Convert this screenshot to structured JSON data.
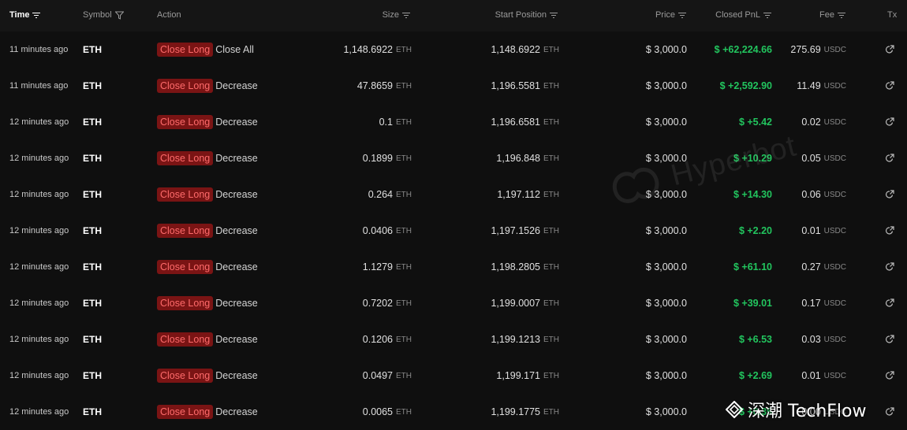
{
  "columns": {
    "time": "Time",
    "symbol": "Symbol",
    "action": "Action",
    "size": "Size",
    "start_position": "Start Position",
    "price": "Price",
    "closed_pnl": "Closed PnL",
    "fee": "Fee",
    "tx": "Tx"
  },
  "rows": [
    {
      "time": "11 minutes ago",
      "symbol": "ETH",
      "action": "Close Long",
      "subaction": "Close All",
      "size": "1,148.6922",
      "size_unit": "ETH",
      "start": "1,148.6922",
      "start_unit": "ETH",
      "price": "$ 3,000.0",
      "pnl": "$ +62,224.66",
      "fee": "275.69",
      "fee_unit": "USDC"
    },
    {
      "time": "11 minutes ago",
      "symbol": "ETH",
      "action": "Close Long",
      "subaction": "Decrease",
      "size": "47.8659",
      "size_unit": "ETH",
      "start": "1,196.5581",
      "start_unit": "ETH",
      "price": "$ 3,000.0",
      "pnl": "$ +2,592.90",
      "fee": "11.49",
      "fee_unit": "USDC"
    },
    {
      "time": "12 minutes ago",
      "symbol": "ETH",
      "action": "Close Long",
      "subaction": "Decrease",
      "size": "0.1",
      "size_unit": "ETH",
      "start": "1,196.6581",
      "start_unit": "ETH",
      "price": "$ 3,000.0",
      "pnl": "$ +5.42",
      "fee": "0.02",
      "fee_unit": "USDC"
    },
    {
      "time": "12 minutes ago",
      "symbol": "ETH",
      "action": "Close Long",
      "subaction": "Decrease",
      "size": "0.1899",
      "size_unit": "ETH",
      "start": "1,196.848",
      "start_unit": "ETH",
      "price": "$ 3,000.0",
      "pnl": "$ +10.29",
      "fee": "0.05",
      "fee_unit": "USDC"
    },
    {
      "time": "12 minutes ago",
      "symbol": "ETH",
      "action": "Close Long",
      "subaction": "Decrease",
      "size": "0.264",
      "size_unit": "ETH",
      "start": "1,197.112",
      "start_unit": "ETH",
      "price": "$ 3,000.0",
      "pnl": "$ +14.30",
      "fee": "0.06",
      "fee_unit": "USDC"
    },
    {
      "time": "12 minutes ago",
      "symbol": "ETH",
      "action": "Close Long",
      "subaction": "Decrease",
      "size": "0.0406",
      "size_unit": "ETH",
      "start": "1,197.1526",
      "start_unit": "ETH",
      "price": "$ 3,000.0",
      "pnl": "$ +2.20",
      "fee": "0.01",
      "fee_unit": "USDC"
    },
    {
      "time": "12 minutes ago",
      "symbol": "ETH",
      "action": "Close Long",
      "subaction": "Decrease",
      "size": "1.1279",
      "size_unit": "ETH",
      "start": "1,198.2805",
      "start_unit": "ETH",
      "price": "$ 3,000.0",
      "pnl": "$ +61.10",
      "fee": "0.27",
      "fee_unit": "USDC"
    },
    {
      "time": "12 minutes ago",
      "symbol": "ETH",
      "action": "Close Long",
      "subaction": "Decrease",
      "size": "0.7202",
      "size_unit": "ETH",
      "start": "1,199.0007",
      "start_unit": "ETH",
      "price": "$ 3,000.0",
      "pnl": "$ +39.01",
      "fee": "0.17",
      "fee_unit": "USDC"
    },
    {
      "time": "12 minutes ago",
      "symbol": "ETH",
      "action": "Close Long",
      "subaction": "Decrease",
      "size": "0.1206",
      "size_unit": "ETH",
      "start": "1,199.1213",
      "start_unit": "ETH",
      "price": "$ 3,000.0",
      "pnl": "$ +6.53",
      "fee": "0.03",
      "fee_unit": "USDC"
    },
    {
      "time": "12 minutes ago",
      "symbol": "ETH",
      "action": "Close Long",
      "subaction": "Decrease",
      "size": "0.0497",
      "size_unit": "ETH",
      "start": "1,199.171",
      "start_unit": "ETH",
      "price": "$ 3,000.0",
      "pnl": "$ +2.69",
      "fee": "0.01",
      "fee_unit": "USDC"
    },
    {
      "time": "12 minutes ago",
      "symbol": "ETH",
      "action": "Close Long",
      "subaction": "Decrease",
      "size": "0.0065",
      "size_unit": "ETH",
      "start": "1,199.1775",
      "start_unit": "ETH",
      "price": "$ 3,000.0",
      "pnl": "$ +0.35",
      "fee": "0.00",
      "fee_unit": "USDC"
    }
  ],
  "watermark": {
    "text": "Hyperbot"
  },
  "brand": {
    "text": "深潮 TechFlow"
  },
  "icons": {
    "sort": "sort-icon",
    "filter": "filter-icon",
    "tx": "external-link-icon"
  },
  "colors": {
    "background": "#0f0f0f",
    "header_bg": "#151515",
    "badge_bg": "#7a1414",
    "badge_text": "#ff6b6b",
    "pnl_positive": "#22c55e",
    "unit": "#888888"
  }
}
